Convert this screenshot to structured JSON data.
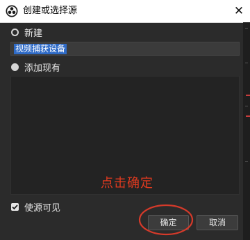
{
  "dialog": {
    "title": "创建或选择源",
    "close_glyph": "✕"
  },
  "options": {
    "create_new_label": "新建",
    "add_existing_label": "添加现有",
    "create_new_selected": true
  },
  "name_field": {
    "value": "视频捕获设备"
  },
  "annotation": {
    "text": "点击确定",
    "color": "#e03a1f"
  },
  "visibility": {
    "label": "使源可见",
    "checked": true
  },
  "buttons": {
    "ok_label": "确定",
    "cancel_label": "取消"
  }
}
